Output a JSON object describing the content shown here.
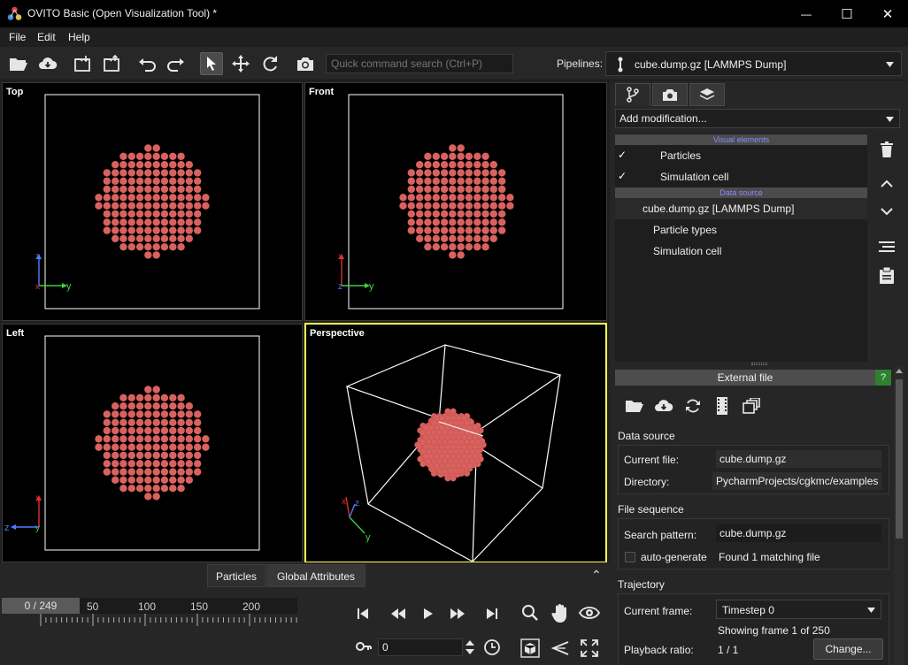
{
  "window": {
    "title": "OVITO Basic (Open Visualization Tool) *",
    "minimize_glyph": "—",
    "maximize_glyph": "☐",
    "close_glyph": "✕"
  },
  "menu": {
    "file": "File",
    "edit": "Edit",
    "help": "Help"
  },
  "toolbar": {
    "quick_search_placeholder": "Quick command search (Ctrl+P)",
    "pipelines_label": "Pipelines:",
    "pipeline_selected": "cube.dump.gz [LAMMPS Dump]"
  },
  "viewports": {
    "top": {
      "label": "Top",
      "axis_up": "z",
      "axis_right": "y",
      "axis_out": "x"
    },
    "front": {
      "label": "Front",
      "axis_up": "x",
      "axis_right": "y",
      "axis_out": "z"
    },
    "left": {
      "label": "Left",
      "axis_up": "x",
      "axis_right": "z",
      "axis_out": "y"
    },
    "perspective": {
      "label": "Perspective",
      "axis_up": "x",
      "axis_right": "y",
      "axis_out": "z"
    }
  },
  "particle_color": "#d9625f",
  "active_viewport_color": "#ffff54",
  "pipeline_editor": {
    "add_modification": "Add modification...",
    "visual_elements_header": "Visual elements",
    "data_source_header": "Data source",
    "visual_elements": [
      {
        "label": "Particles",
        "checked": true,
        "check_glyph": "✓"
      },
      {
        "label": "Simulation cell",
        "checked": true,
        "check_glyph": "✓"
      }
    ],
    "data_source_item": "cube.dump.gz [LAMMPS Dump]",
    "data_source_children": [
      "Particle types",
      "Simulation cell"
    ]
  },
  "external_file": {
    "header": "External file",
    "help_glyph": "?",
    "data_source_group": "Data source",
    "current_file_label": "Current file:",
    "current_file_value": "cube.dump.gz",
    "directory_label": "Directory:",
    "directory_value": "PycharmProjects/cgkmc/examples",
    "file_sequence_group": "File sequence",
    "search_pattern_label": "Search pattern:",
    "search_pattern_value": "cube.dump.gz",
    "auto_generate_label": "auto-generate",
    "matching_info": "Found 1 matching file",
    "trajectory_group": "Trajectory",
    "current_frame_label": "Current frame:",
    "current_frame_value": "Timestep 0",
    "showing_frame": "Showing frame 1 of 250",
    "playback_ratio_label": "Playback ratio:",
    "playback_ratio_value": "1 / 1",
    "change_button": "Change..."
  },
  "bottom": {
    "tab_particles": "Particles",
    "tab_global_attributes": "Global Attributes",
    "collapse_glyph": "⌃",
    "frame_indicator": "0 / 249",
    "ticks": [
      "50",
      "100",
      "150",
      "200"
    ],
    "frame_spinner_value": "0"
  }
}
